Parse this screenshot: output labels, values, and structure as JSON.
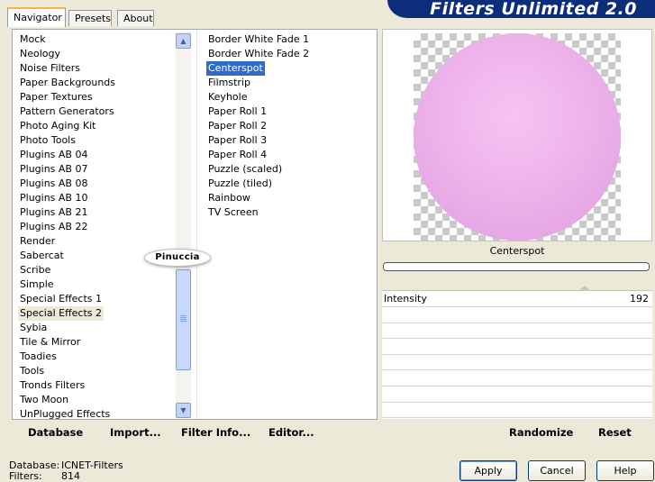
{
  "tabs": {
    "navigator": "Navigator",
    "presets": "Presets",
    "about": "About"
  },
  "banner": {
    "title": "Filters Unlimited 2.0"
  },
  "categories": [
    "Mock",
    "Neology",
    "Noise Filters",
    "Paper Backgrounds",
    "Paper Textures",
    "Pattern Generators",
    "Photo Aging Kit",
    "Photo Tools",
    "Plugins AB 04",
    "Plugins AB 07",
    "Plugins AB 08",
    "Plugins AB 10",
    "Plugins AB 21",
    "Plugins AB 22",
    "Render",
    "Sabercat",
    "Scribe",
    "Simple",
    "Special Effects 1",
    "Special Effects 2",
    "Sybia",
    "Tile & Mirror",
    "Toadies",
    "Tools",
    "Tronds Filters",
    "Two Moon",
    "UnPlugged Effects"
  ],
  "selected_category": "Special Effects 2",
  "filters": [
    "Border White Fade 1",
    "Border White Fade 2",
    "Centerspot",
    "Filmstrip",
    "Keyhole",
    "Paper Roll 1",
    "Paper Roll 2",
    "Paper Roll 3",
    "Paper Roll 4",
    "Puzzle (scaled)",
    "Puzzle (tiled)",
    "Rainbow",
    "TV Screen"
  ],
  "selected_filter": "Centerspot",
  "watermark": "Pinuccia",
  "bottom_buttons": {
    "database": "Database",
    "import": "Import...",
    "filter_info": "Filter Info...",
    "editor": "Editor..."
  },
  "preview": {
    "filter_name": "Centerspot"
  },
  "params": [
    {
      "label": "Intensity",
      "value": "192"
    }
  ],
  "right_buttons": {
    "randomize": "Randomize",
    "reset": "Reset"
  },
  "status": {
    "database_label": "Database:",
    "database_value": "ICNET-Filters",
    "filters_label": "Filters:",
    "filters_value": "814"
  },
  "dialog_buttons": {
    "apply": "Apply",
    "cancel": "Cancel",
    "help": "Help"
  },
  "colors": {
    "selection": "#316ac5",
    "banner": "#0b2d7a",
    "accent_tab": "#f9b43d",
    "preview_fill": "#efb5ec"
  }
}
